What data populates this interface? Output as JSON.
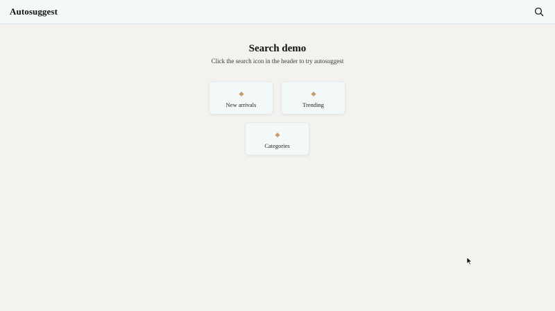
{
  "header": {
    "brand": "Autosuggest",
    "search_icon": "search-icon"
  },
  "main": {
    "title": "Search demo",
    "subtitle": "Click the search icon in the header to try autosuggest",
    "cards": [
      {
        "label": "New arrivals",
        "icon": "diamond-icon"
      },
      {
        "label": "Trending",
        "icon": "diamond-icon"
      },
      {
        "label": "Categories",
        "icon": "diamond-icon"
      }
    ]
  },
  "colors": {
    "page_bg": "#f4f2ef",
    "header_bg": "#f3f8f8",
    "card_bg": "#f3f8f8",
    "accent": "#c79a6e"
  }
}
